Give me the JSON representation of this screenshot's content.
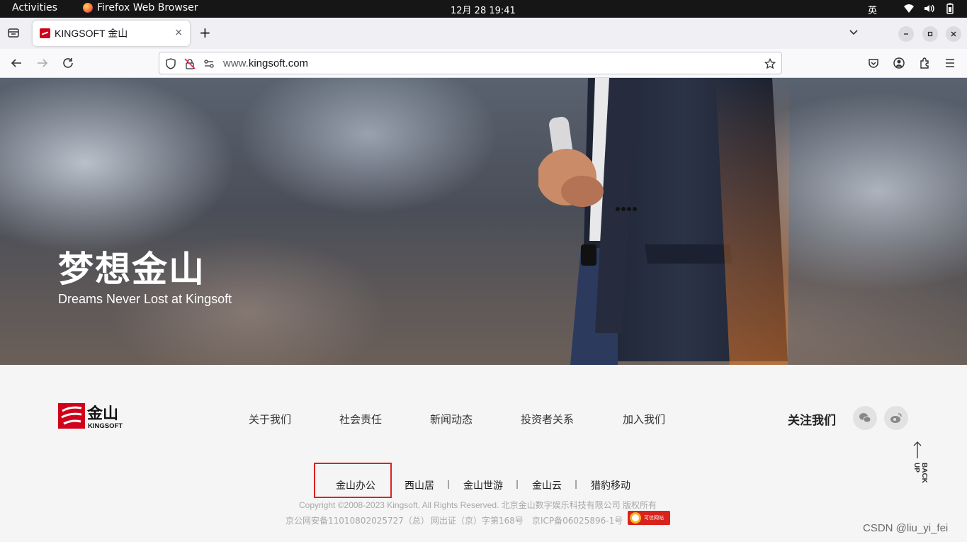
{
  "system_bar": {
    "activities": "Activities",
    "app_name": "Firefox Web Browser",
    "clock": "12月 28  19:41",
    "input_method": "英"
  },
  "browser": {
    "tab_title": "KINGSOFT 金山",
    "url_prefix": "www.",
    "url_domain": "kingsoft.com",
    "tab_close": "×",
    "new_tab": "+"
  },
  "hero": {
    "headline": "梦想金山",
    "tagline": "Dreams Never Lost at Kingsoft"
  },
  "footer": {
    "logo_cn": "金山",
    "logo_en": "KINGSOFT",
    "nav": [
      "关于我们",
      "社会责任",
      "新闻动态",
      "投资者关系",
      "加入我们"
    ],
    "follow_label": "关注我们",
    "back_up": "BACK UP",
    "companies": [
      "金山办公",
      "西山居",
      "金山世游",
      "金山云",
      "猎豹移动"
    ],
    "separator": "|",
    "copyright": "Copyright ©2008-2023 Kingsoft, All Rights Reserved. 北京金山数字娱乐科技有限公司 版权所有",
    "license_police": "京公网安备11010802025727（总）",
    "license_net": "网出证（京）字第168号",
    "license_icp": "京ICP备06025896-1号",
    "badge_text": "可信网站"
  },
  "watermark": "CSDN @liu_yi_fei",
  "colors": {
    "brand_red": "#d0021b",
    "highlight_box": "#e02020",
    "footer_bg": "#f5f5f5"
  }
}
